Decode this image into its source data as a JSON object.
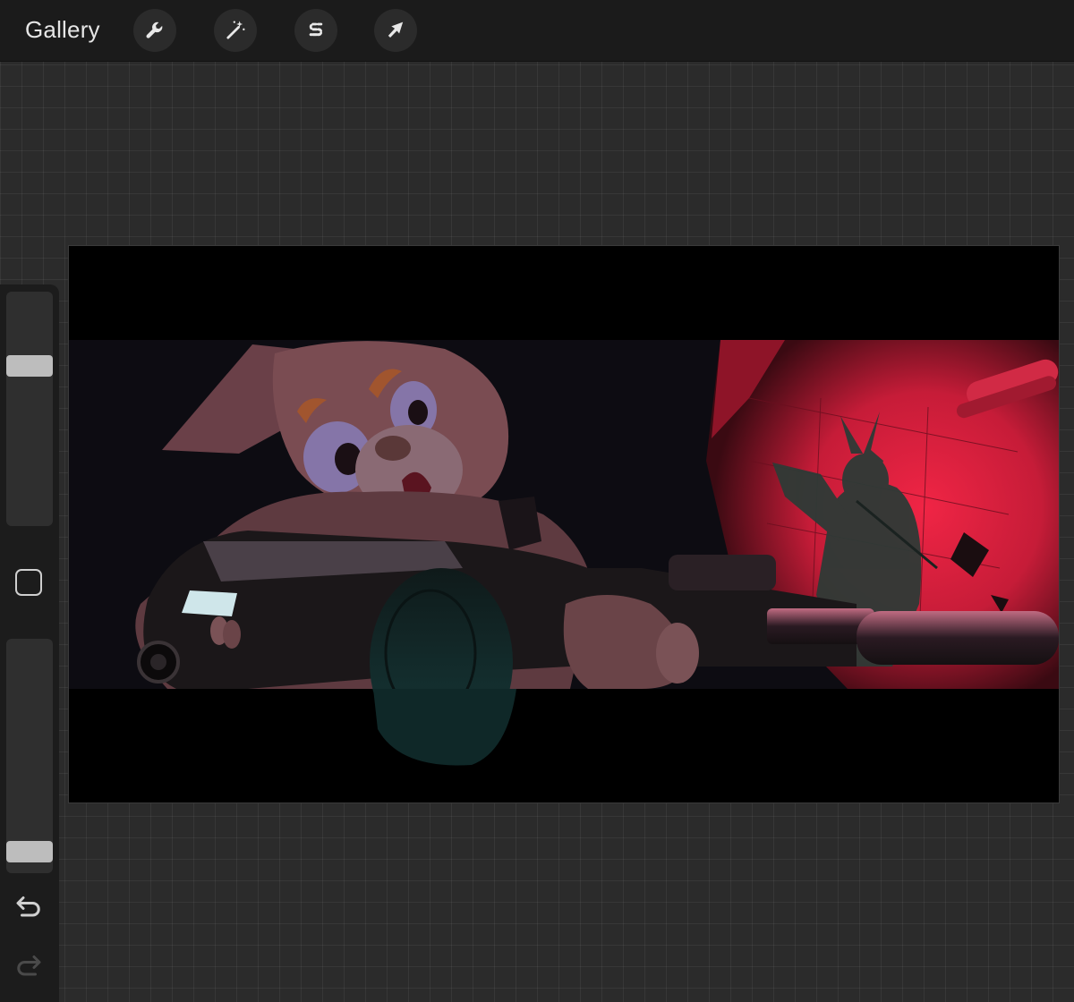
{
  "toolbar": {
    "gallery_label": "Gallery",
    "tools": [
      {
        "name": "actions",
        "icon": "wrench-icon"
      },
      {
        "name": "adjustments",
        "icon": "magic-wand-icon"
      },
      {
        "name": "selection",
        "icon": "selection-s-icon"
      },
      {
        "name": "transform",
        "icon": "arrow-cursor-icon"
      }
    ]
  },
  "sidebar": {
    "brush_size": 0.7,
    "opacity": 0.05,
    "icons": [
      "modify-square-icon",
      "undo-icon",
      "redo-icon"
    ]
  },
  "colors": {
    "toolbar_bg": "#1b1b1b",
    "workspace_bg": "#2b2b2b",
    "canvas_bg": "#000000",
    "accent_red": "#e0203c"
  }
}
